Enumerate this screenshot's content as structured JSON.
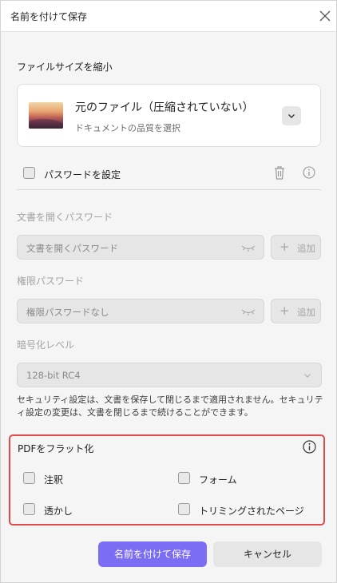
{
  "dialog": {
    "title": "名前を付けて保存",
    "close_icon": "close-icon"
  },
  "compress": {
    "section_label": "ファイルサイズを縮小",
    "file_title": "元のファイル（圧縮されていない）",
    "file_subtitle": "ドキュメントの品質を選択",
    "thumbnail": "landscape-thumbnail",
    "dropdown_icon": "chevron-down-icon"
  },
  "password": {
    "checkbox_label": "パスワードを設定",
    "checked": false,
    "delete_icon": "trash-icon",
    "info_icon": "info-icon",
    "open_label": "文書を開くパスワード",
    "open_placeholder": "文書を開くパスワード",
    "permission_label": "権限パスワード",
    "permission_placeholder": "権限パスワードなし",
    "add_label": "追加",
    "encryption_label": "暗号化レベル",
    "encryption_value": "128-bit RC4",
    "hint": "セキュリティ設定は、文書を保存して閉じるまで適用されません。セキュリティ設定の変更は、文書を閉じるまで続けることができます。"
  },
  "flatten": {
    "title": "PDFをフラット化",
    "info_icon": "info-icon",
    "options": {
      "annotations": {
        "label": "注釈",
        "checked": false
      },
      "forms": {
        "label": "フォーム",
        "checked": false
      },
      "watermark": {
        "label": "透かし",
        "checked": false
      },
      "cropped": {
        "label": "トリミングされたページ",
        "checked": false
      }
    }
  },
  "buttons": {
    "save": "名前を付けて保存",
    "cancel": "キャンセル"
  },
  "colors": {
    "accent": "#7c6ef4",
    "highlight_border": "#e04a4a"
  }
}
